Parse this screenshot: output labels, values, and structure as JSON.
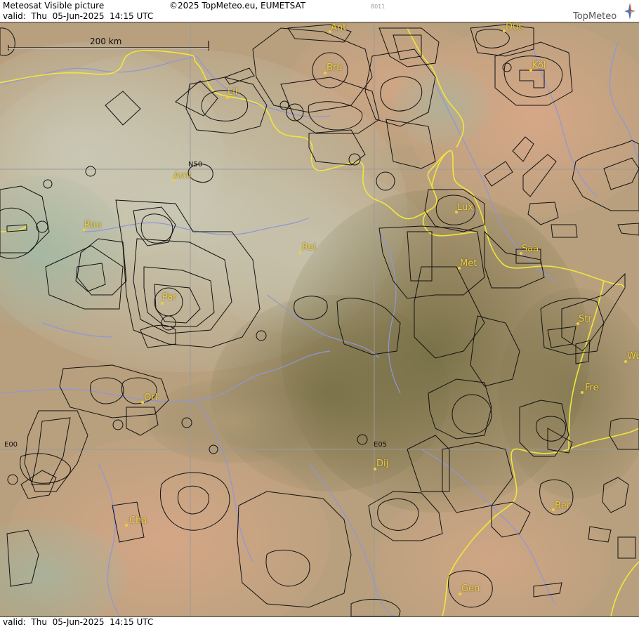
{
  "header": {
    "title": "Meteosat Visible picture",
    "valid": "valid:  Thu  05-Jun-2025  14:15 UTC",
    "copyright": "©2025 TopMeteo.eu, EUMETSAT",
    "code": "8011",
    "brand": "TopMeteo",
    "brand_icon": "compass-star-icon"
  },
  "footer": {
    "valid": "valid:  Thu  05-Jun-2025  14:15 UTC"
  },
  "scale": {
    "label": "200 km"
  },
  "grid_labels": {
    "n50": "N50",
    "e00": "E00",
    "e05": "E05"
  },
  "cities": {
    "ant": "Ant",
    "dus": "Düs",
    "bru": "Bru",
    "kol": "Köl",
    "lil": "Lil",
    "ami": "Ami",
    "lux": "Lux",
    "rou": "Rou",
    "rei": "Rei",
    "saa": "Saa",
    "met": "Met",
    "par": "Par",
    "str": "Str",
    "wur": "Wü",
    "fre": "Fre",
    "orl": "Orl",
    "dij": "Dij",
    "ber": "Ber",
    "cha": "Cha",
    "gen": "Gen"
  },
  "colors": {
    "border": "#f0e63a",
    "river": "#8f96d8",
    "airspace": "#111111",
    "city": "#f2d033",
    "grid": "#9a9a9a"
  }
}
